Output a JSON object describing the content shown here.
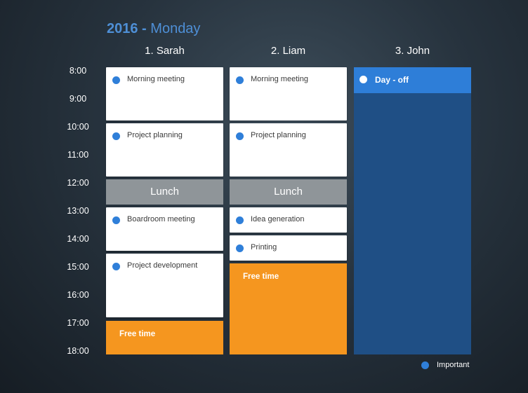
{
  "header": {
    "year": "2016 -",
    "day": "Monday"
  },
  "people": [
    {
      "name": "1. Sarah"
    },
    {
      "name": "2. Liam"
    },
    {
      "name": "3. John"
    }
  ],
  "times": [
    "8:00",
    "9:00",
    "10:00",
    "11:00",
    "12:00",
    "13:00",
    "14:00",
    "15:00",
    "16:00",
    "17:00",
    "18:00"
  ],
  "sarah": {
    "morning_meeting": "Morning meeting",
    "project_planning": "Project planning",
    "lunch": "Lunch",
    "boardroom_meeting": "Boardroom meeting",
    "project_development": "Project development",
    "free_time": "Free time"
  },
  "liam": {
    "morning_meeting": "Morning meeting",
    "project_planning": "Project planning",
    "lunch": "Lunch",
    "idea_generation": "Idea generation",
    "printing": "Printing",
    "free_time": "Free time"
  },
  "john": {
    "day_off": "Day - off"
  },
  "legend": {
    "important": "Important"
  },
  "colors": {
    "important": "#2f7fd9",
    "free_time": "#f5961f",
    "lunch": "#8f9599",
    "day_off_bar": "#2e7ed8",
    "day_off_column": "#1f4f85",
    "title_accent": "#4e8fd6"
  }
}
